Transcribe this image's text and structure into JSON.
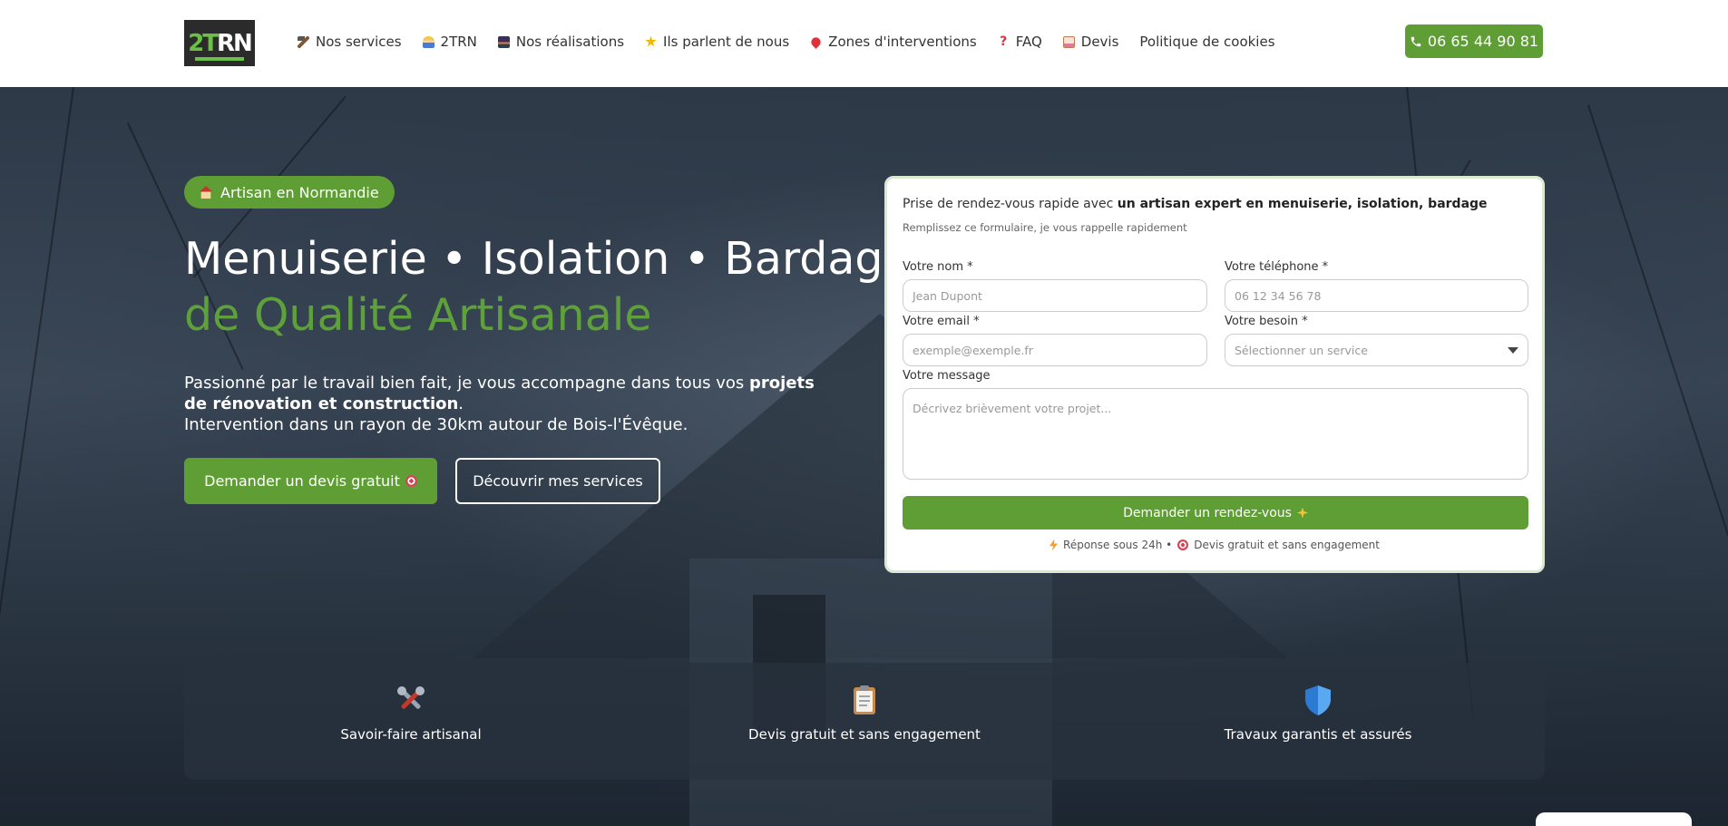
{
  "header": {
    "logo_text_a": "2T",
    "logo_text_b": "RN",
    "nav": [
      {
        "label": "Nos services",
        "icon": "hammer-icon",
        "color": "#7a5a3a"
      },
      {
        "label": "2TRN",
        "icon": "worker-icon",
        "color": "#4a7bd0"
      },
      {
        "label": "Nos réalisations",
        "icon": "photo-icon",
        "color": "#6a4c8c"
      },
      {
        "label": "Ils parlent de nous",
        "icon": "star-icon",
        "color": "#f5b800"
      },
      {
        "label": "Zones d'interventions",
        "icon": "pin-icon",
        "color": "#e0303a"
      },
      {
        "label": "FAQ",
        "icon": "question-icon",
        "color": "#e0303a"
      },
      {
        "label": "Devis",
        "icon": "memo-icon",
        "color": "#c07a5a"
      },
      {
        "label": "Politique de cookies",
        "icon": "",
        "color": ""
      }
    ],
    "phone": "06 65 44 90 81"
  },
  "hero": {
    "badge": "Artisan en Normandie",
    "title": "Menuiserie • Isolation • Bardage",
    "subtitle": "de Qualité Artisanale",
    "desc_part1": "Passionné par le travail bien fait, je vous accompagne dans tous vos ",
    "desc_bold": "projets de rénovation et construction",
    "desc_part2": ".",
    "desc_line2": "Intervention dans un rayon de 30km autour de Bois-l'Évêque.",
    "cta_primary": "Demander un devis gratuit",
    "cta_secondary": "Découvrir mes services"
  },
  "form": {
    "intro_plain": "Prise de rendez-vous rapide avec ",
    "intro_bold": "un artisan expert en menuiserie, isolation, bardage",
    "sub": "Remplissez ce formulaire, je vous rappelle rapidement",
    "name_label": "Votre nom *",
    "name_placeholder": "Jean Dupont",
    "phone_label": "Votre téléphone *",
    "phone_placeholder": "06 12 34 56 78",
    "email_label": "Votre email *",
    "email_placeholder": "exemple@exemple.fr",
    "need_label": "Votre besoin *",
    "need_selected": "Sélectionner un service",
    "message_label": "Votre message",
    "message_placeholder": "Décrivez brièvement votre projet...",
    "submit": "Demander un rendez-vous",
    "foot_a": "Réponse sous 24h •",
    "foot_b": "Devis gratuit et sans engagement"
  },
  "features": [
    {
      "label": "Savoir-faire artisanal",
      "icon": "tools-icon"
    },
    {
      "label": "Devis gratuit et sans engagement",
      "icon": "clipboard-icon"
    },
    {
      "label": "Travaux garantis et assurés",
      "icon": "shield-icon"
    }
  ],
  "colors": {
    "accent": "#5e9e35",
    "accent_text": "#5ea03a",
    "header_bg": "#ffffff"
  }
}
